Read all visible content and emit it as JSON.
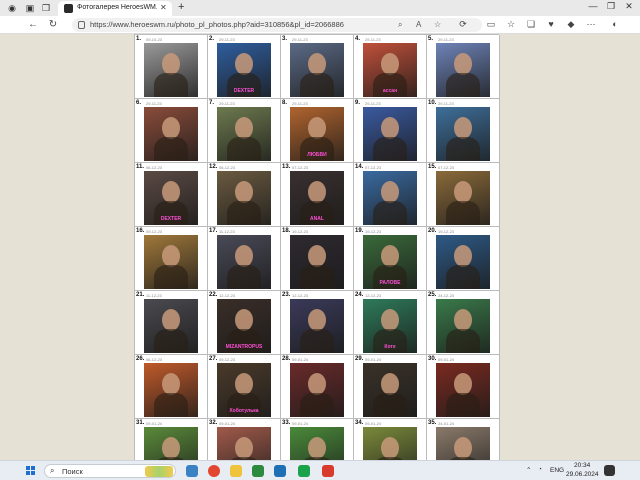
{
  "browser": {
    "tab_title": "Фотогалерея HeroesWM. andr...",
    "url": "https://www.heroeswm.ru/photo_pl_photos.php?aid=310856&pl_id=2066886",
    "new_tab_symbol": "+",
    "close_symbol": "✕"
  },
  "gallery": {
    "cells": [
      {
        "num": "1.",
        "date": "09-10-23",
        "bg": "#9a9a9a",
        "cap": ""
      },
      {
        "num": "2.",
        "date": "29-11-23",
        "bg": "#2f5e9e",
        "cap": "DEXTER"
      },
      {
        "num": "3.",
        "date": "29-11-23",
        "bg": "#5b6a86",
        "cap": ""
      },
      {
        "num": "4.",
        "date": "29-11-23",
        "bg": "#c0503a",
        "cap": "ассан"
      },
      {
        "num": "5.",
        "date": "29-11-23",
        "bg": "#6e84b8",
        "cap": ""
      },
      {
        "num": "6.",
        "date": "29-11-23",
        "bg": "#8a4c3a",
        "cap": ""
      },
      {
        "num": "7.",
        "date": "29-11-23",
        "bg": "#6d7a4e",
        "cap": ""
      },
      {
        "num": "8.",
        "date": "29-11-23",
        "bg": "#b0642e",
        "cap": "ЛЮБВИ"
      },
      {
        "num": "9.",
        "date": "29-11-23",
        "bg": "#3a5aa0",
        "cap": ""
      },
      {
        "num": "10.",
        "date": "29-11-23",
        "bg": "#3e6f9a",
        "cap": ""
      },
      {
        "num": "11.",
        "date": "06-12-23",
        "bg": "#5a4a44",
        "cap": "DEXTER"
      },
      {
        "num": "12.",
        "date": "06-12-23",
        "bg": "#6a5a40",
        "cap": ""
      },
      {
        "num": "13.",
        "date": "07-12-23",
        "bg": "#3a3030",
        "cap": "ANAL"
      },
      {
        "num": "14.",
        "date": "07-12-23",
        "bg": "#3a6aa0",
        "cap": ""
      },
      {
        "num": "15.",
        "date": "07-12-23",
        "bg": "#8a6a3a",
        "cap": ""
      },
      {
        "num": "16.",
        "date": "09-12-23",
        "bg": "#a0783a",
        "cap": ""
      },
      {
        "num": "17.",
        "date": "11-12-23",
        "bg": "#4a4a58",
        "cap": ""
      },
      {
        "num": "18.",
        "date": "19-12-23",
        "bg": "#2e2a30",
        "cap": ""
      },
      {
        "num": "19.",
        "date": "19-12-23",
        "bg": "#3a6a3a",
        "cap": "РАЛОВЕ"
      },
      {
        "num": "20.",
        "date": "19-12-23",
        "bg": "#2e5a86",
        "cap": ""
      },
      {
        "num": "21.",
        "date": "11-12-23",
        "bg": "#4a4a50",
        "cap": ""
      },
      {
        "num": "22.",
        "date": "12-12-23",
        "bg": "#3a2e28",
        "cap": "MIZANTROPUS"
      },
      {
        "num": "23.",
        "date": "12-12-23",
        "bg": "#3a3a5a",
        "cap": ""
      },
      {
        "num": "24.",
        "date": "12-12-23",
        "bg": "#2e7a5a",
        "cap": "Коте"
      },
      {
        "num": "25.",
        "date": "24-12-23",
        "bg": "#3a7a4a",
        "cap": ""
      },
      {
        "num": "26.",
        "date": "06-12-23",
        "bg": "#c05a2a",
        "cap": ""
      },
      {
        "num": "27.",
        "date": "09-12-23",
        "bg": "#4a3a2a",
        "cap": "Хоботулька"
      },
      {
        "num": "28.",
        "date": "09-01-24",
        "bg": "#6a2a2a",
        "cap": ""
      },
      {
        "num": "29.",
        "date": "09-01-24",
        "bg": "#3a3228",
        "cap": ""
      },
      {
        "num": "30.",
        "date": "09-01-24",
        "bg": "#7a2a20",
        "cap": ""
      },
      {
        "num": "31.",
        "date": "09-01-24",
        "bg": "#5a8a3a",
        "cap": ""
      },
      {
        "num": "32.",
        "date": "09-01-24",
        "bg": "#a05a4a",
        "cap": ""
      },
      {
        "num": "33.",
        "date": "09-01-24",
        "bg": "#4a8a3a",
        "cap": ""
      },
      {
        "num": "34.",
        "date": "09-01-24",
        "bg": "#7a8a3a",
        "cap": ""
      },
      {
        "num": "35.",
        "date": "24-01-24",
        "bg": "#8a7a6a",
        "cap": ""
      }
    ]
  },
  "taskbar": {
    "search_label": "Поиск",
    "lang": "ENG",
    "time": "20:34",
    "date": "29.06.2024"
  }
}
